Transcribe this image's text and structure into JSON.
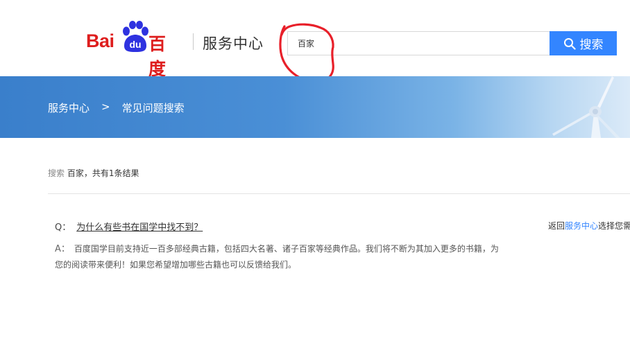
{
  "header": {
    "logo_text": "Bai",
    "logo_du": "du",
    "logo_cn": "百度",
    "service_title": "服务中心",
    "brand_color": "#de1e1e"
  },
  "search": {
    "value": "百家",
    "button_label": "搜索",
    "button_color": "#3385ff"
  },
  "breadcrumb": {
    "home": "服务中心",
    "separator": ">",
    "current": "常见问题搜索"
  },
  "results": {
    "prefix": "搜索",
    "keyword": "百家",
    "count_text": "，共有1条结果"
  },
  "faq": [
    {
      "q_prefix": "Q：",
      "question": "为什么有些书在国学中找不到？",
      "a_prefix": "A：",
      "answer": "百度国学目前支持近一百多部经典古籍，包括四大名著、诸子百家等经典作品。我们将不断为其加入更多的书籍，为您的阅读带来便利！如果您希望增加哪些古籍也可以反馈给我们。"
    }
  ],
  "back_link": {
    "before": "返回",
    "link": "服务中心",
    "after": "选择您需"
  },
  "icons": {
    "search": "search-icon",
    "paw": "baidu-paw-icon"
  }
}
